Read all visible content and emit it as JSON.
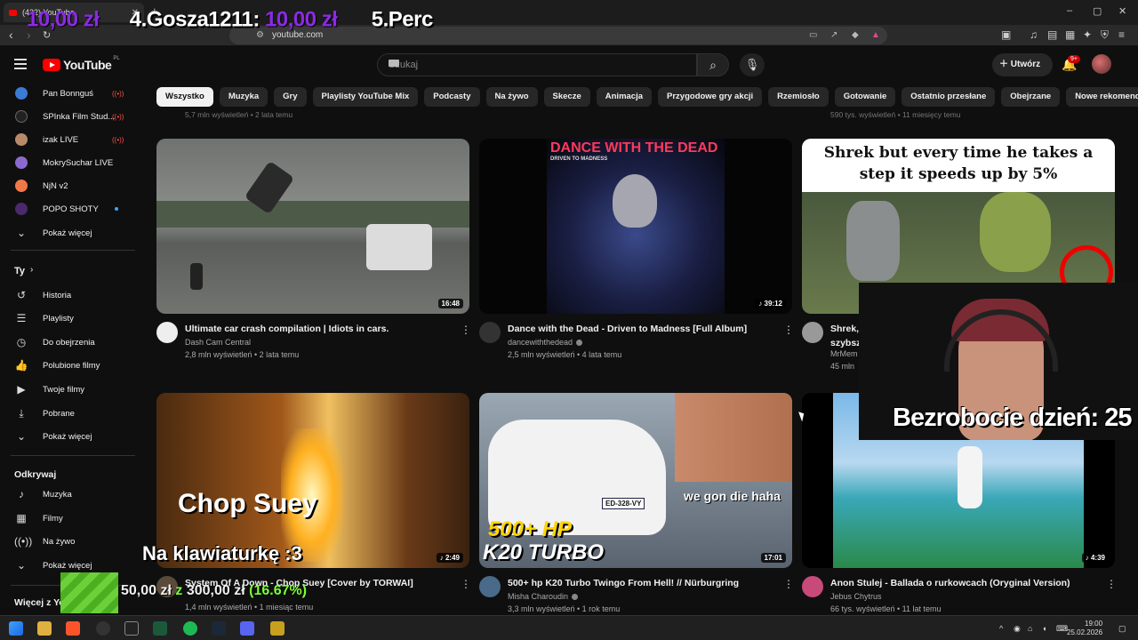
{
  "browser": {
    "tab_title": "(432) YouTube",
    "url": "youtube.com"
  },
  "ticker": {
    "left_amount": "10,00 zł",
    "rank_4": "4.Gosza1211:",
    "amount_4": "10,00 zł",
    "rank_5": "5.Perc"
  },
  "header": {
    "logo_text": "YouTube",
    "logo_region": "PL",
    "search_placeholder": "Szukaj",
    "create_label": "Utwórz",
    "notif_badge": "9+"
  },
  "chips": [
    "Wszystko",
    "Muzyka",
    "Gry",
    "Playlisty YouTube Mix",
    "Podcasty",
    "Na żywo",
    "Skecze",
    "Animacja",
    "Przygodowe gry akcji",
    "Rzemiosło",
    "Gotowanie",
    "Ostatnio przesłane",
    "Obejrzane",
    "Nowe rekomendacje"
  ],
  "sidebar": {
    "subscriptions": [
      {
        "label": "Pan Bonnguś",
        "status": "live"
      },
      {
        "label": "SPInka Film Stud...",
        "status": "live"
      },
      {
        "label": "izak LIVE",
        "status": "live"
      },
      {
        "label": "MokrySuchar LIVE",
        "status": ""
      },
      {
        "label": "NjN v2",
        "status": ""
      },
      {
        "label": "POPO SHOTY",
        "status": "new"
      }
    ],
    "show_more": "Pokaż więcej",
    "you_heading": "Ty",
    "you_items": [
      "Historia",
      "Playlisty",
      "Do obejrzenia",
      "Polubione filmy",
      "Twoje filmy",
      "Pobrane",
      "Pokaż więcej"
    ],
    "explore_heading": "Odkrywaj",
    "explore_items": [
      "Muzyka",
      "Filmy",
      "Na żywo",
      "Pokaż więcej"
    ],
    "more_heading": "Więcej z Yo"
  },
  "prev_row": [
    "5,7 mln wyświetleń • 2 lata temu",
    "590 tys. wyświetleń • 11 miesięcy temu"
  ],
  "videos": [
    {
      "title": "Ultimate car crash compilation | Idiots in cars.",
      "channel": "Dash Cam Central",
      "meta": "2,8 mln wyświetleń • 2 lata temu",
      "duration": "16:48"
    },
    {
      "title": "Dance with the Dead - Driven to Madness [Full Album]",
      "channel": "dancewiththedead",
      "meta": "2,5 mln wyświetleń • 4 lata temu",
      "duration": "39:12",
      "thumb_title": "DANCE WITH THE DEAD",
      "thumb_sub": "DRIVEN TO MADNESS"
    },
    {
      "title": "Shrek,",
      "title2": "szybsz",
      "channel": "MrMem",
      "meta": "45 mln",
      "duration": "",
      "thumb_text": "Shrek but every time he takes a step it speeds up by 5%"
    },
    {
      "title": "System Of A Down - Chop Suey [Cover by TORWAI]",
      "channel": "",
      "meta": "1,4 mln wyświetleń • 1 miesiąc temu",
      "duration": "2:49",
      "thumb_text": "Chop Suey"
    },
    {
      "title": "500+ hp K20 Turbo Twingo From Hell! // Nürburgring",
      "channel": "Misha Charoudin",
      "meta": "3,3 mln wyświetleń • 1 rok temu",
      "duration": "17:01",
      "thumb_text1": "500+ HP",
      "thumb_text2": "K20 TURBO",
      "thumb_text3": "we gon die haha",
      "plate": "ED-328-VY"
    },
    {
      "title": "Anon Stulej - Ballada o rurkowcach (Oryginal Version)",
      "channel": "Jebus Chytrus",
      "meta": "66 tys. wyświetleń • 11 lat temu",
      "duration": "4:39"
    }
  ],
  "overlays": {
    "caption": "Na klawiaturkę :3",
    "webcam_text": "Bezrobocie dzień: 25",
    "goal_current": "50,00 zł",
    "goal_sep": "z",
    "goal_target": "300,00 zł",
    "goal_pct": "(16.67%)"
  },
  "taskbar": {
    "time": "19:00",
    "date": "25.02.2026"
  }
}
